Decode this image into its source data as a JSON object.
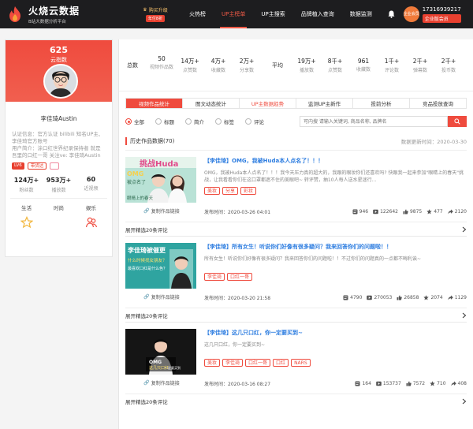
{
  "brand": {
    "title": "火烧云数据",
    "subtitle": "B站大数据分析平台"
  },
  "promo": {
    "text": "购买升级",
    "badge": "年付8折"
  },
  "nav": [
    {
      "label": "火热榜",
      "active": false
    },
    {
      "label": "UP主榜单",
      "active": true
    },
    {
      "label": "UP主搜索",
      "active": false
    },
    {
      "label": "品牌植入查询",
      "active": false
    },
    {
      "label": "数据监测",
      "active": false
    }
  ],
  "user": {
    "avatar_text": "企业会员",
    "phone": "17316939217",
    "member": "企业版会员"
  },
  "profile": {
    "fans_count": "625",
    "fans_label": "云指数",
    "name": "李佳琦Austin",
    "desc": "认证信息：官方认证  bilibili 知名UP主、李佳琦官方账号",
    "desc2": "用户简介：涂口红世界纪录保持者 就是吾里的口红一哥 关注ve: 李佳琦Austin",
    "tags": [
      "LV6",
      "带货达"
    ],
    "stats": [
      {
        "value": "124万+",
        "label": "粉丝数"
      },
      {
        "value": "953万+",
        "label": "播放数"
      },
      {
        "value": "60",
        "label": "近视频"
      }
    ],
    "cats": [
      "生活",
      "时尚",
      "娱乐"
    ]
  },
  "summary": {
    "group1_label": "总数",
    "group1": [
      {
        "value": "50",
        "label": "视频作品数"
      },
      {
        "value": "14万+",
        "label": "点赞数"
      },
      {
        "value": "4万+",
        "label": "收藏数"
      },
      {
        "value": "2万+",
        "label": "分享数"
      }
    ],
    "group2_label": "平均",
    "group2": [
      {
        "value": "19万+",
        "label": "播放数"
      },
      {
        "value": "8千+",
        "label": "点赞数"
      },
      {
        "value": "961",
        "label": "收藏数"
      },
      {
        "value": "1千+",
        "label": "评论数"
      },
      {
        "value": "2千+",
        "label": "弹幕数"
      },
      {
        "value": "2千+",
        "label": "投币数"
      }
    ]
  },
  "tabs": [
    "视频作品统计",
    "图文动态统计",
    "UP主数据趋势",
    "监测UP主新作",
    "投前分析",
    "竞品投放查询"
  ],
  "filters": [
    "全部",
    "标题",
    "简介",
    "标签",
    "评论"
  ],
  "search_placeholder": "可内搜 请输入关键词, 商品名称, 品牌名",
  "section": {
    "title": "历史作品数据(70)",
    "time": "数据更新时间：2020-03-30"
  },
  "copy_label": "复制作品链接",
  "expand_label": "展开精选20条评论",
  "posts": [
    {
      "title": "【李佳琦】OMG，我被Huda本人点名了！！！",
      "desc": "OMG，我被Huda本人点名了！！！我今天压力真的超大的，我跟的眼妆你们还喜欢吗? 快跟我一起来参加\"眼睛上的春天\"挑战，让我看看你们在这口罩都遮不住的美眼吧~ 转评赞，抽10人每人送水星迷行...",
      "tags": [
        "美妆",
        "分享",
        "彩妆"
      ],
      "time": "发布时间：2020-03-26 04:01",
      "stats": [
        "946",
        "122642",
        "9875",
        "477",
        "2120"
      ]
    },
    {
      "title": "【李佳琦】所有女生！听说你们好像有很多疑问？我来回答你们的问题啦！！",
      "desc": "所有女生！听说你们好像有很多疑问？我来回答你们的问题啦！！不过你们的问题真的一点都不晦利诶~",
      "tags": [
        "李佳琦",
        "口红一哥"
      ],
      "time": "发布时间：2020-03-20 21:58",
      "stats": [
        "4790",
        "270053",
        "26858",
        "2074",
        "1129"
      ]
    },
    {
      "title": "【李佳琦】这几只口红，你一定要买到~",
      "desc": "这几只口红，你一定要买到~",
      "tags": [
        "美妆",
        "李佳琦",
        "口红一哥",
        "口红",
        "NARS"
      ],
      "time": "发布时间：2020-03-16 08:27",
      "stats": [
        "164",
        "153737",
        "7572",
        "710",
        "408"
      ]
    }
  ],
  "thumbs": [
    {
      "line1": "OMG",
      "line2": "被点名了",
      "line3": "挑战Huda",
      "line4": "眼睛上的春天"
    },
    {
      "line1": "李佳琦被催更",
      "line2": "什么时候找女朋友？",
      "line3": "最喜欢口红是什么色？",
      "line4": ""
    },
    {
      "line1": "OMG",
      "line2": "这几只口红",
      "line3": "一定要买到",
      "line4": ""
    }
  ]
}
